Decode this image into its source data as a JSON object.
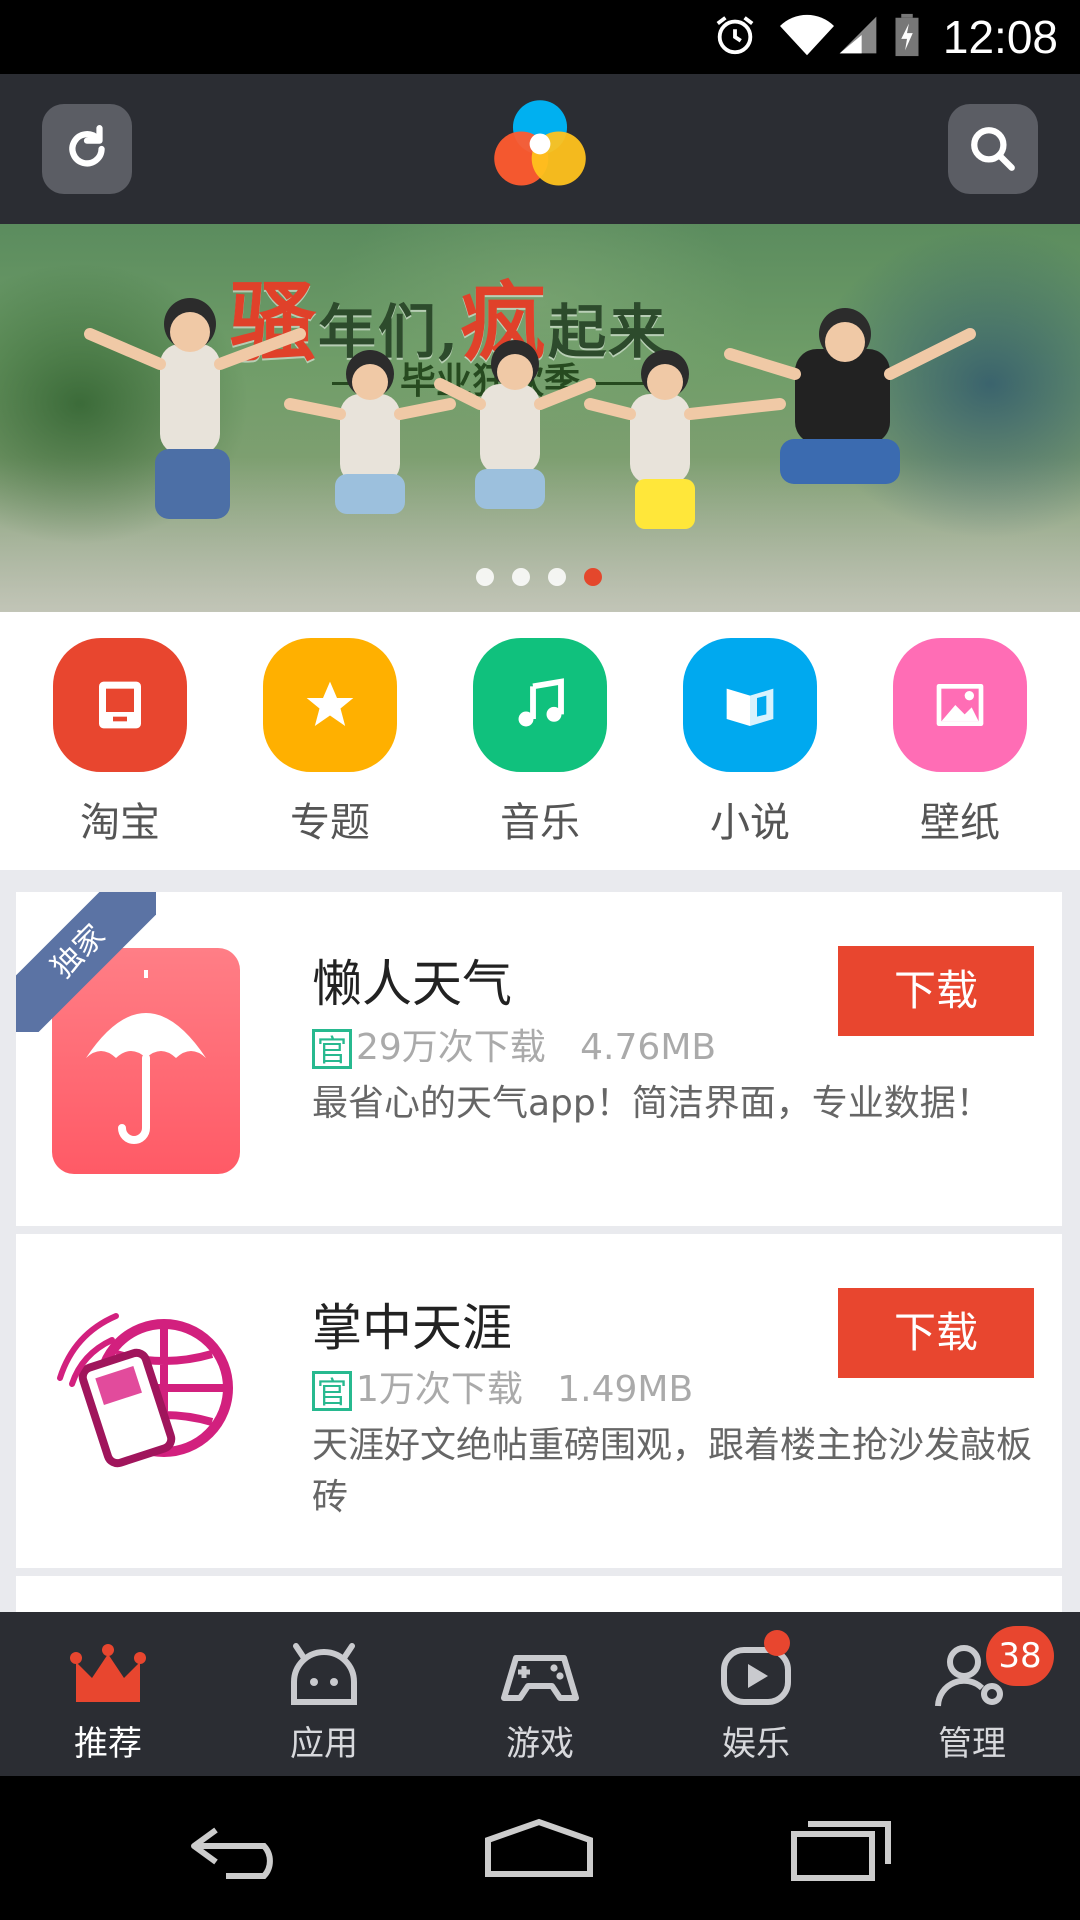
{
  "status": {
    "time": "12:08"
  },
  "banner": {
    "title_part1": "骚",
    "title_part2": "年们,",
    "title_part3": "疯",
    "title_part4": "起来",
    "subtitle": "毕业狂欢季",
    "pages": 4,
    "active_page": 4
  },
  "categories": [
    {
      "label": "淘宝",
      "color": "#e8462f",
      "icon": "tv-icon"
    },
    {
      "label": "专题",
      "color": "#ffb000",
      "icon": "star-icon"
    },
    {
      "label": "音乐",
      "color": "#10c17d",
      "icon": "music-icon"
    },
    {
      "label": "小说",
      "color": "#00a9ef",
      "icon": "book-icon"
    },
    {
      "label": "壁纸",
      "color": "#ff6db5",
      "icon": "image-icon"
    }
  ],
  "apps": [
    {
      "badge": "独家",
      "name": "懒人天气",
      "official": "官",
      "downloads": "29万次下载",
      "size": "4.76MB",
      "description": "最省心的天气app！简洁界面，专业数据！",
      "button": "下载"
    },
    {
      "name": "掌中天涯",
      "official": "官",
      "downloads": "1万次下载",
      "size": "1.49MB",
      "description": "天涯好文绝帖重磅围观，跟着楼主抢沙发敲板砖",
      "button": "下载"
    }
  ],
  "bottom_nav": [
    {
      "label": "推荐",
      "icon": "crown-icon",
      "active": true
    },
    {
      "label": "应用",
      "icon": "android-icon"
    },
    {
      "label": "游戏",
      "icon": "gamepad-icon"
    },
    {
      "label": "娱乐",
      "icon": "play-icon"
    },
    {
      "label": "管理",
      "icon": "user-gear-icon",
      "badge": "38"
    }
  ],
  "colors": {
    "accent": "#e8462f",
    "topbar": "#2b2d33",
    "official": "#27b98f"
  }
}
